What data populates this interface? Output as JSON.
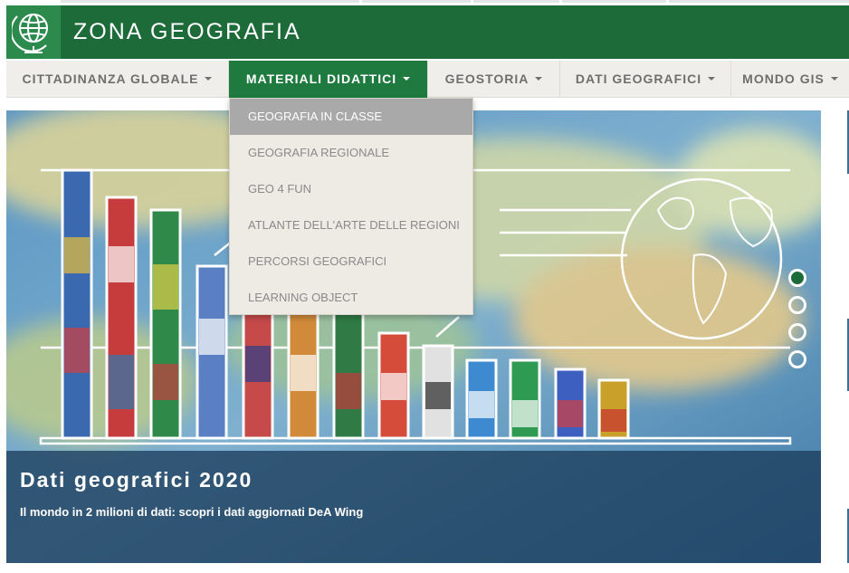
{
  "header": {
    "site_title": "ZONA GEOGRAFIA",
    "brand_color": "#1e6b3a",
    "logo_icon": "globe-icon"
  },
  "nav": {
    "items": [
      {
        "label": "CITTADINANZA GLOBALE",
        "active": false
      },
      {
        "label": "MATERIALI DIDATTICI",
        "active": true
      },
      {
        "label": "GEOSTORIA",
        "active": false
      },
      {
        "label": "DATI GEOGRAFICI",
        "active": false
      },
      {
        "label": "MONDO GIS",
        "active": false
      }
    ],
    "active_color": "#1e7a3e"
  },
  "dropdown": {
    "items": [
      {
        "label": "GEOGRAFIA IN CLASSE",
        "hovered": true
      },
      {
        "label": "GEOGRAFIA REGIONALE",
        "hovered": false
      },
      {
        "label": "GEO 4 FUN",
        "hovered": false
      },
      {
        "label": "ATLANTE DELL'ARTE DELLE REGIONI",
        "hovered": false
      },
      {
        "label": "PERCORSI GEOGRAFICI",
        "hovered": false
      },
      {
        "label": "LEARNING OBJECT",
        "hovered": false
      }
    ]
  },
  "slider": {
    "title": "Dati geografici 2020",
    "subtitle": "Il mondo in 2 milioni di dati: scopri i dati aggiornati DeA Wing",
    "slide_count": 4,
    "active_slide": 1
  }
}
